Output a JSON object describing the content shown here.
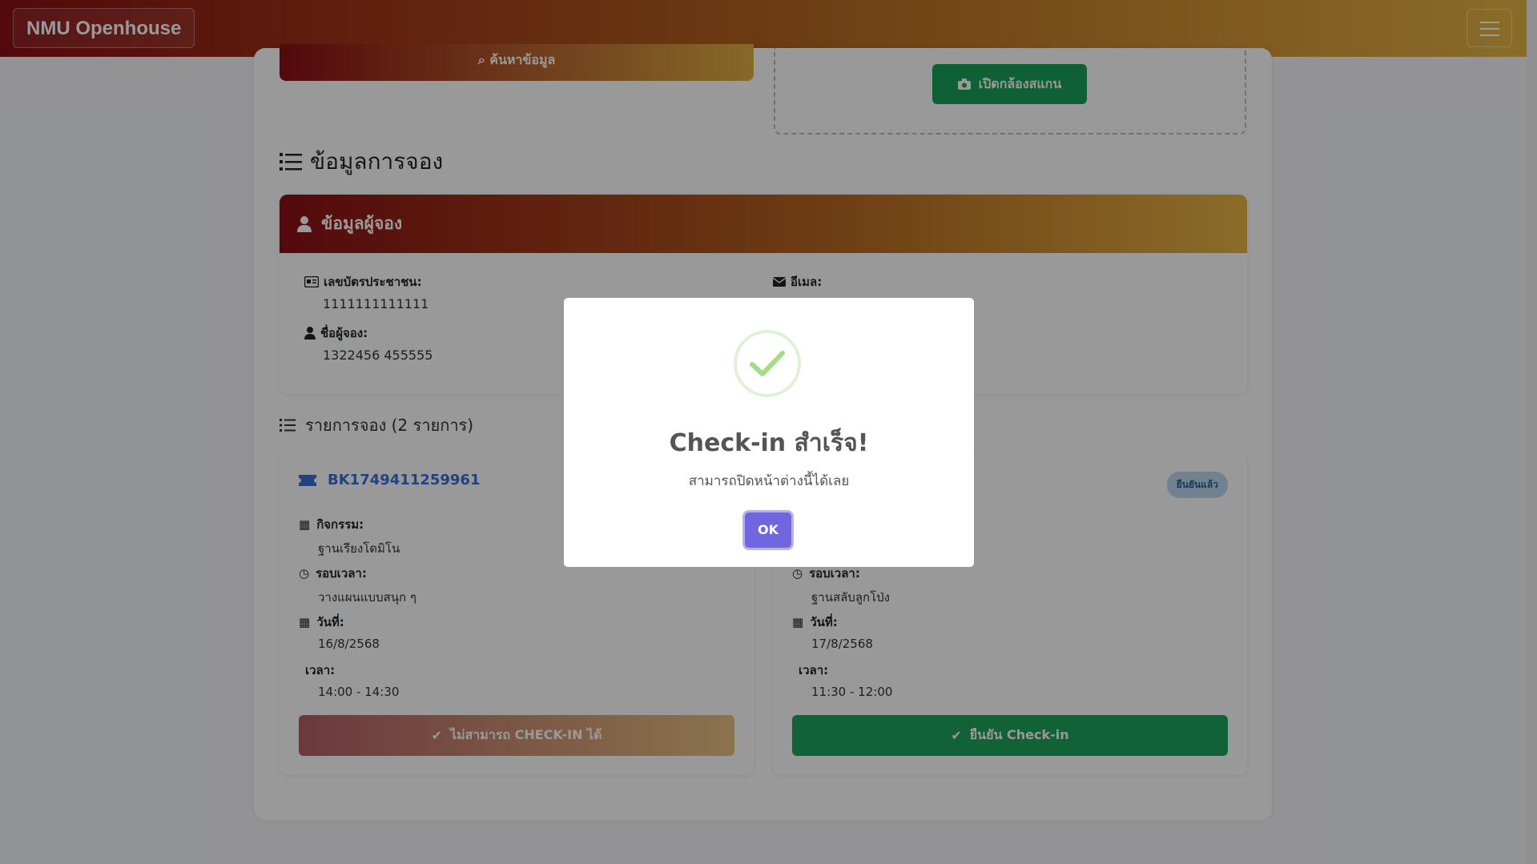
{
  "navbar": {
    "brand": "NMU Openhouse"
  },
  "toolbar": {
    "search_label": "ค้นหาข้อมูล",
    "scan_label": "เปิดกล้องสแกน"
  },
  "section": {
    "title": "ข้อมูลการจอง"
  },
  "booker": {
    "header": "ข้อมูลผู้จอง",
    "id_label": "เลขบัตรประชาชน:",
    "id_value": "1111111111111",
    "email_label": "อีเมล:",
    "name_label": "ชื่อผู้จอง:",
    "name_value": "1322456 455555"
  },
  "bookings": {
    "title": "รายการจอง (2 รายการ)",
    "items": [
      {
        "code": "BK1749411259961",
        "activity_label": "กิจกรรม:",
        "activity_value": "ฐานเรียงโดมิโน",
        "round_label": "รอบเวลา:",
        "round_value": "วางแผนแบบสนุก ๆ",
        "date_label": "วันที่:",
        "date_value": "16/8/2568",
        "time_label": "เวลา:",
        "time_value": "14:00 - 14:30",
        "action": "ไม่สามารถ CHECK-IN ได้"
      },
      {
        "badge": "ยืนยันแล้ว",
        "round_label": "รอบเวลา:",
        "round_value": "ฐานสลับลูกโป่ง",
        "date_label": "วันที่:",
        "date_value": "17/8/2568",
        "time_label": "เวลา:",
        "time_value": "11:30 - 12:00",
        "action": "ยืนยัน Check-in"
      }
    ]
  },
  "modal": {
    "title": "Check-in สำเร็จ!",
    "text": "สามารถปิดหน้าต่างนี้ได้เลย",
    "ok": "OK"
  },
  "colors": {
    "brand_start": "#8b0f14",
    "brand_end": "#e7b545",
    "success": "#19a157",
    "link": "#3b6fd8",
    "modal_button": "#7066e0"
  }
}
